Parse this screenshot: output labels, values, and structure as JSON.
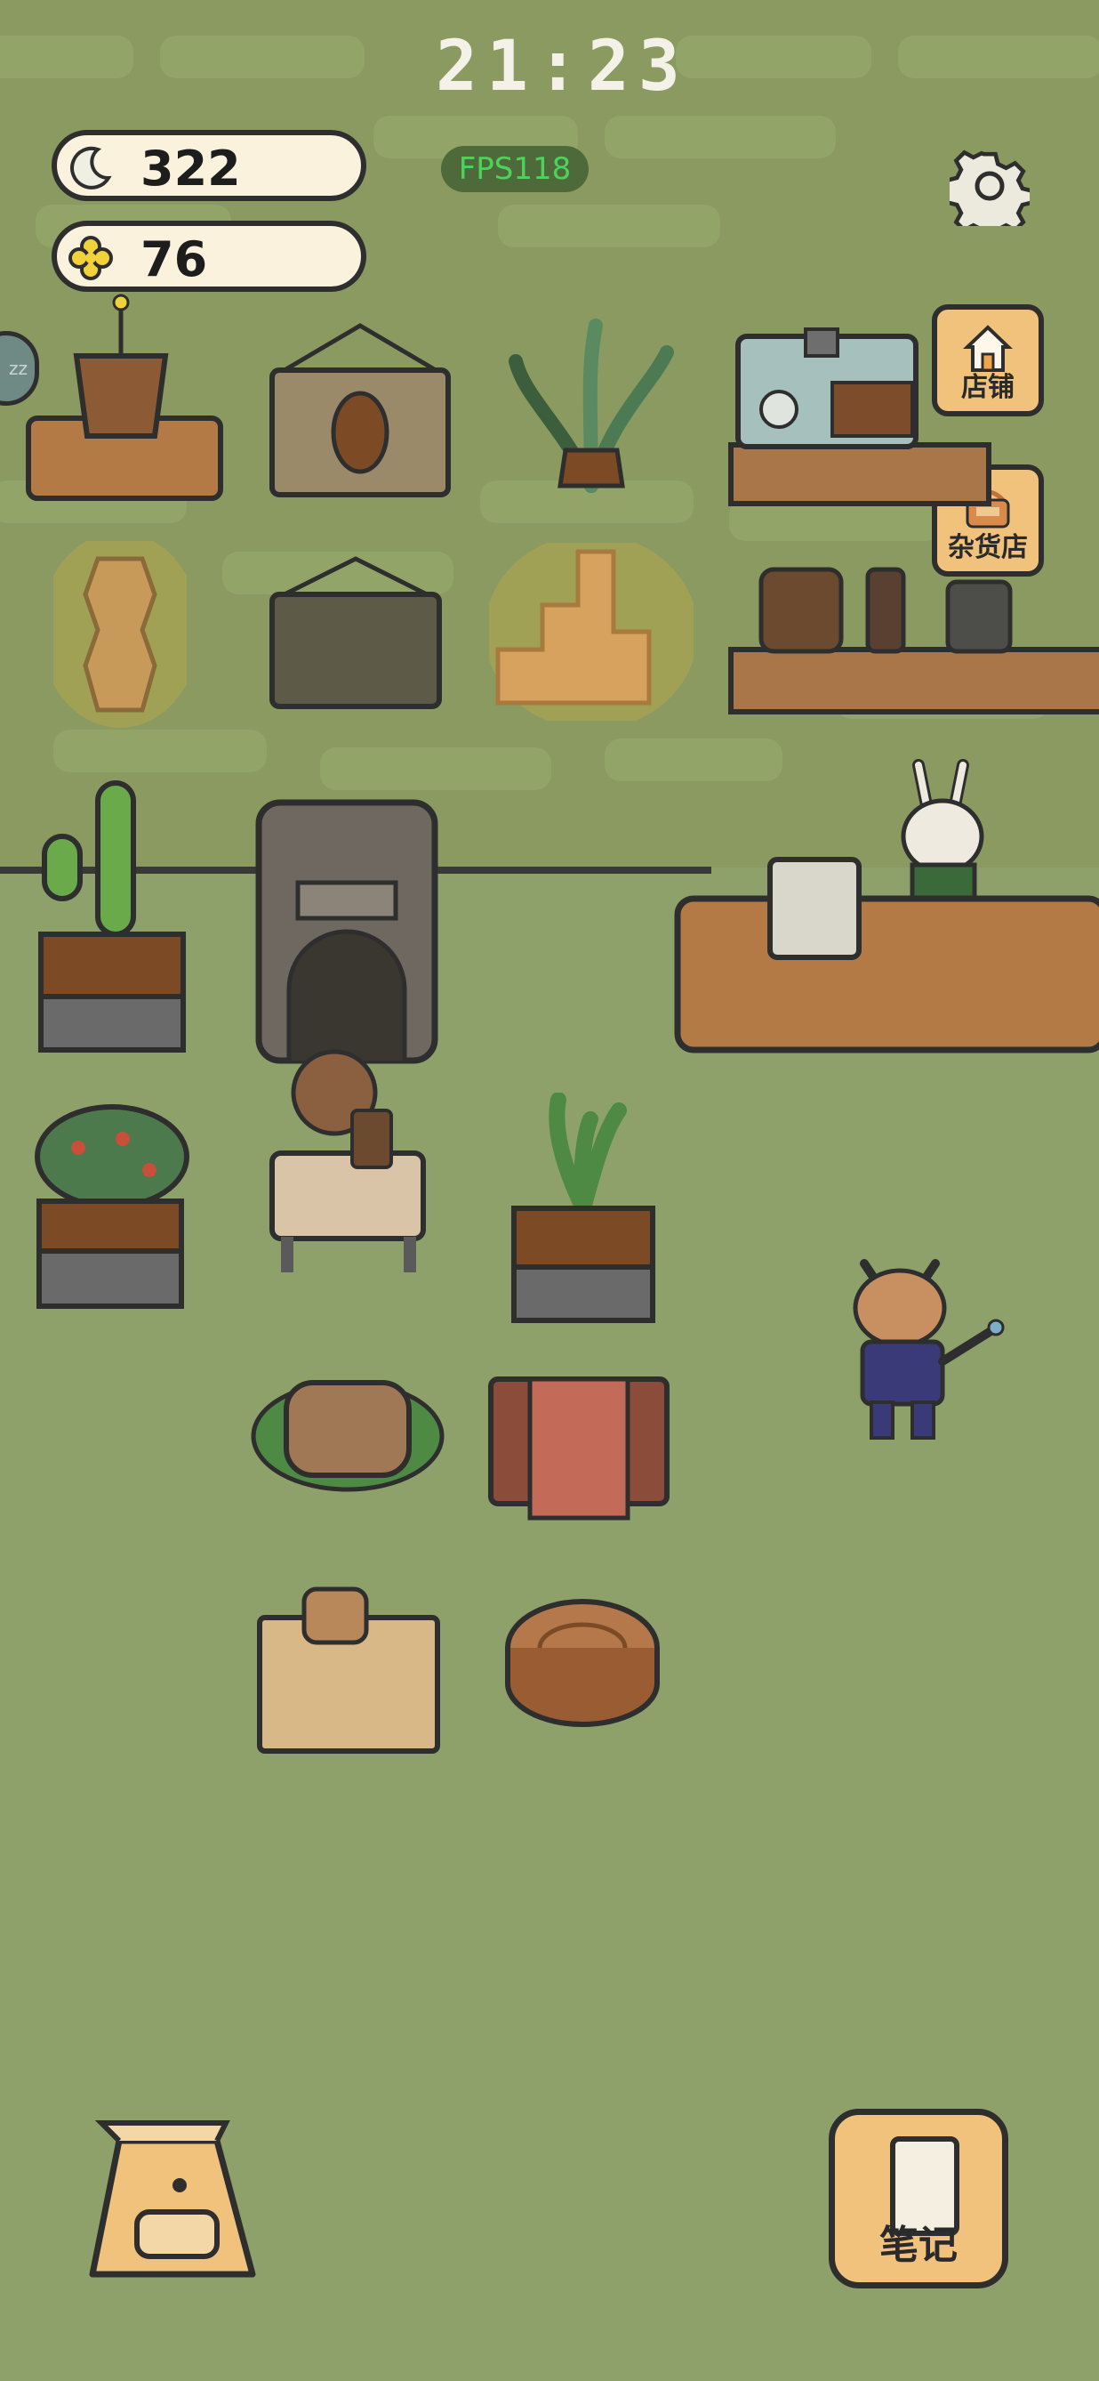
{
  "status_bar": {
    "clock": "21:23",
    "fps": "FPS118"
  },
  "currencies": [
    {
      "icon": "moon-icon",
      "value": "322"
    },
    {
      "icon": "clover-icon",
      "value": "76"
    }
  ],
  "side_menu": [
    {
      "icon": "house-icon",
      "label": "店铺"
    },
    {
      "icon": "basket-icon",
      "label": "杂货店"
    }
  ],
  "bottom_bar": {
    "backpack_icon": "backpack-icon",
    "notes_label": "笔记"
  },
  "edge_badge": {
    "text": "zz"
  },
  "colors": {
    "wall": "#8a9a60",
    "floor": "#8fa16b",
    "button": "#f0c27c",
    "pill": "#fbf2de",
    "fps_text": "#4ed35a"
  }
}
